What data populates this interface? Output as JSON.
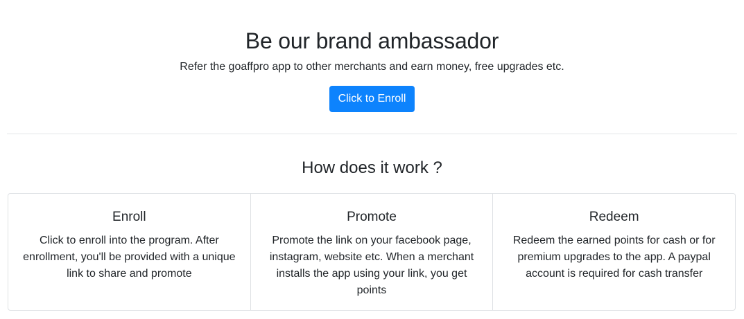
{
  "hero": {
    "title": "Be our brand ambassador",
    "subtitle": "Refer the goaffpro app to other merchants and earn money, free upgrades etc.",
    "enroll_button_label": "Click to Enroll"
  },
  "how_it_works": {
    "title": "How does it work ?",
    "cards": [
      {
        "title": "Enroll",
        "text": "Click to enroll into the program. After enrollment, you'll be provided with a unique link to share and promote"
      },
      {
        "title": "Promote",
        "text": "Promote the link on your facebook page, instagram, website etc. When a merchant installs the app using your link, you get points"
      },
      {
        "title": "Redeem",
        "text": "Redeem the earned points for cash or for premium upgrades to the app. A paypal account is required for cash transfer"
      }
    ]
  },
  "colors": {
    "primary_button": "#0d83fd",
    "text": "#212529",
    "border": "#dee1e4"
  }
}
